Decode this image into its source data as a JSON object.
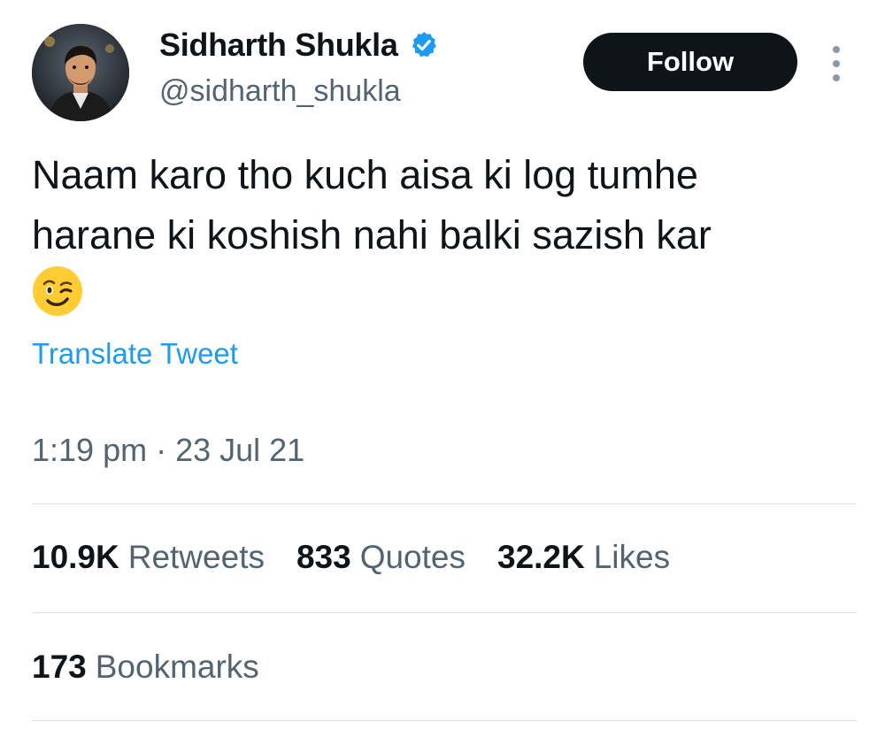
{
  "author": {
    "name": "Sidharth Shukla",
    "handle": "@sidharth_shukla",
    "verified_color": "#1d9bf0"
  },
  "actions": {
    "follow_label": "Follow",
    "more_icon": "more-vertical-icon"
  },
  "tweet": {
    "text_line1": "Naam karo tho kuch aisa ki log tumhe",
    "text_line2": "harane ki koshish nahi balki sazish kar",
    "emoji": "winking-face-emoji",
    "translate_label": "Translate Tweet",
    "timestamp": "1:19 pm · 23 Jul 21"
  },
  "stats": {
    "retweets": {
      "count": "10.9K",
      "label": "Retweets"
    },
    "quotes": {
      "count": "833",
      "label": "Quotes"
    },
    "likes": {
      "count": "32.2K",
      "label": "Likes"
    },
    "bookmarks": {
      "count": "173",
      "label": "Bookmarks"
    }
  },
  "colors": {
    "accent": "#1d9bf0",
    "text": "#0f1419",
    "secondary": "#536471",
    "button": "#0f1419"
  }
}
